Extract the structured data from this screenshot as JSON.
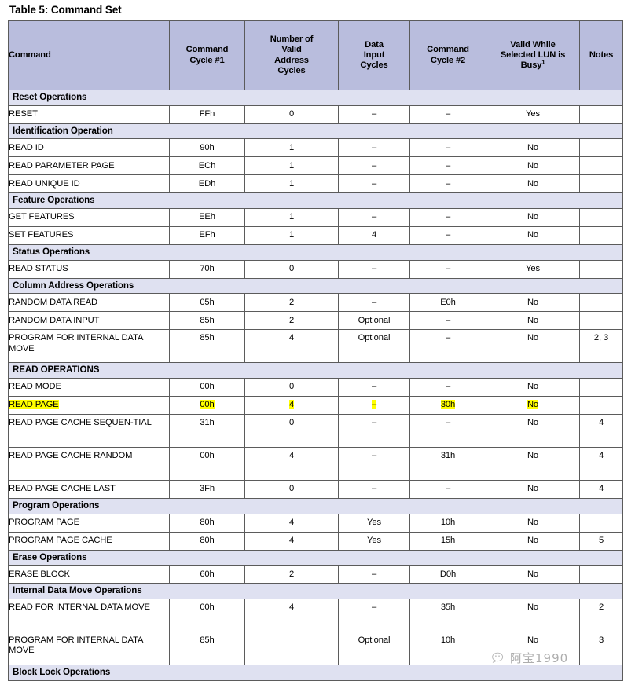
{
  "title": "Table 5: Command Set",
  "columns": [
    {
      "id": "command",
      "label": "Command",
      "lines": [
        "Command"
      ]
    },
    {
      "id": "cycle1",
      "label": "Command Cycle #1",
      "lines": [
        "Command",
        "Cycle #1"
      ]
    },
    {
      "id": "addr_cycles",
      "label": "Number of Valid Address Cycles",
      "lines": [
        "Number of",
        "Valid",
        "Address",
        "Cycles"
      ]
    },
    {
      "id": "data_input",
      "label": "Data Input Cycles",
      "lines": [
        "Data",
        "Input",
        "Cycles"
      ]
    },
    {
      "id": "cycle2",
      "label": "Command Cycle #2",
      "lines": [
        "Command",
        "Cycle #2"
      ]
    },
    {
      "id": "valid_busy",
      "label": "Valid While Selected LUN is Busy",
      "lines": [
        "Valid While",
        "Selected LUN is",
        "Busy"
      ],
      "footnote": "1"
    },
    {
      "id": "notes",
      "label": "Notes",
      "lines": [
        "Notes"
      ]
    }
  ],
  "rows": [
    {
      "kind": "section",
      "label": "Reset Operations"
    },
    {
      "kind": "data",
      "command": "RESET",
      "cycle1": "FFh",
      "addr_cycles": "0",
      "data_input": "–",
      "cycle2": "–",
      "valid_busy": "Yes",
      "notes": ""
    },
    {
      "kind": "section",
      "label": "Identification Operation"
    },
    {
      "kind": "data",
      "command": "READ ID",
      "cycle1": "90h",
      "addr_cycles": "1",
      "data_input": "–",
      "cycle2": "–",
      "valid_busy": "No",
      "notes": ""
    },
    {
      "kind": "data",
      "command": "READ PARAMETER PAGE",
      "cycle1": "ECh",
      "addr_cycles": "1",
      "data_input": "–",
      "cycle2": "–",
      "valid_busy": "No",
      "notes": ""
    },
    {
      "kind": "data",
      "command": "READ UNIQUE ID",
      "cycle1": "EDh",
      "addr_cycles": "1",
      "data_input": "–",
      "cycle2": "–",
      "valid_busy": "No",
      "notes": ""
    },
    {
      "kind": "section",
      "label": "Feature Operations"
    },
    {
      "kind": "data",
      "command": "GET FEATURES",
      "cycle1": "EEh",
      "addr_cycles": "1",
      "data_input": "–",
      "cycle2": "–",
      "valid_busy": "No",
      "notes": ""
    },
    {
      "kind": "data",
      "command": "SET FEATURES",
      "cycle1": "EFh",
      "addr_cycles": "1",
      "data_input": "4",
      "cycle2": "–",
      "valid_busy": "No",
      "notes": ""
    },
    {
      "kind": "section",
      "label": "Status Operations"
    },
    {
      "kind": "data",
      "command": "READ STATUS",
      "cycle1": "70h",
      "addr_cycles": "0",
      "data_input": "–",
      "cycle2": "–",
      "valid_busy": "Yes",
      "notes": ""
    },
    {
      "kind": "section",
      "label": "Column Address Operations"
    },
    {
      "kind": "data",
      "command": "RANDOM DATA READ",
      "cycle1": "05h",
      "addr_cycles": "2",
      "data_input": "–",
      "cycle2": "E0h",
      "valid_busy": "No",
      "notes": ""
    },
    {
      "kind": "data",
      "command": "RANDOM DATA INPUT",
      "cycle1": "85h",
      "addr_cycles": "2",
      "data_input": "Optional",
      "cycle2": "–",
      "valid_busy": "No",
      "notes": ""
    },
    {
      "kind": "data",
      "tall": true,
      "command": "PROGRAM FOR INTERNAL DATA MOVE",
      "cycle1": "85h",
      "addr_cycles": "4",
      "data_input": "Optional",
      "cycle2": "–",
      "valid_busy": "No",
      "notes": "2, 3"
    },
    {
      "kind": "section",
      "label": "READ OPERATIONS"
    },
    {
      "kind": "data",
      "command": "READ MODE",
      "cycle1": "00h",
      "addr_cycles": "0",
      "data_input": "–",
      "cycle2": "–",
      "valid_busy": "No",
      "notes": ""
    },
    {
      "kind": "data",
      "highlighted": true,
      "command": "READ PAGE",
      "cycle1": "00h",
      "addr_cycles": "4",
      "data_input": "–",
      "cycle2": "30h",
      "valid_busy": "No",
      "notes": ""
    },
    {
      "kind": "data",
      "tall": true,
      "command": "READ PAGE CACHE SEQUEN-TIAL",
      "cycle1": "31h",
      "addr_cycles": "0",
      "data_input": "–",
      "cycle2": "–",
      "valid_busy": "No",
      "notes": "4"
    },
    {
      "kind": "data",
      "tall": true,
      "command": "READ PAGE CACHE RANDOM",
      "cycle1": "00h",
      "addr_cycles": "4",
      "data_input": "–",
      "cycle2": "31h",
      "valid_busy": "No",
      "notes": "4"
    },
    {
      "kind": "data",
      "command": "READ PAGE CACHE LAST",
      "cycle1": "3Fh",
      "addr_cycles": "0",
      "data_input": "–",
      "cycle2": "–",
      "valid_busy": "No",
      "notes": "4"
    },
    {
      "kind": "section",
      "label": "Program Operations"
    },
    {
      "kind": "data",
      "command": "PROGRAM PAGE",
      "cycle1": "80h",
      "addr_cycles": "4",
      "data_input": "Yes",
      "cycle2": "10h",
      "valid_busy": "No",
      "notes": ""
    },
    {
      "kind": "data",
      "command": "PROGRAM PAGE CACHE",
      "cycle1": "80h",
      "addr_cycles": "4",
      "data_input": "Yes",
      "cycle2": "15h",
      "valid_busy": "No",
      "notes": "5"
    },
    {
      "kind": "section",
      "label": "Erase Operations"
    },
    {
      "kind": "data",
      "command": "ERASE BLOCK",
      "cycle1": "60h",
      "addr_cycles": "2",
      "data_input": "–",
      "cycle2": "D0h",
      "valid_busy": "No",
      "notes": ""
    },
    {
      "kind": "section",
      "label": "Internal Data Move Operations"
    },
    {
      "kind": "data",
      "tall": true,
      "command": "READ FOR INTERNAL DATA MOVE",
      "cycle1": "00h",
      "addr_cycles": "4",
      "data_input": "–",
      "cycle2": "35h",
      "valid_busy": "No",
      "notes": "2"
    },
    {
      "kind": "data",
      "tall": true,
      "command": "PROGRAM FOR INTERNAL DATA MOVE",
      "cycle1": "85h",
      "addr_cycles": "",
      "data_input": "Optional",
      "cycle2": "10h",
      "valid_busy": "No",
      "notes": "3"
    },
    {
      "kind": "section",
      "label": "Block Lock Operations"
    }
  ],
  "watermark": {
    "text": "阿宝1990",
    "icon": "wechat-icon"
  },
  "colors": {
    "header_bg": "#b9bddd",
    "section_bg": "#dfe1f1",
    "highlight": "#ffff00",
    "border": "#5b5b5b"
  }
}
